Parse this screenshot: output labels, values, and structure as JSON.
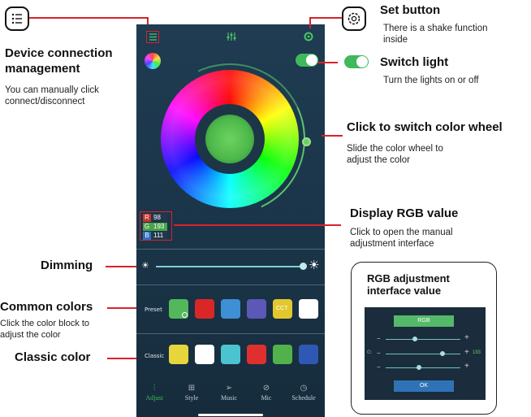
{
  "phone": {
    "rgb": {
      "r_label": "R",
      "r_value": "98",
      "g_label": "G",
      "g_value": "193",
      "b_label": "B",
      "b_value": "111"
    },
    "preset_label": "Preset",
    "classic_label": "Classic",
    "cct_label": "CCT",
    "preset_colors": [
      "#53b85b",
      "#d92727",
      "#3e8fd4",
      "#5b58b6",
      "#e3c72e",
      "#ffffff"
    ],
    "classic_colors": [
      "#e6d63a",
      "#ffffff",
      "#4cc4d0",
      "#df2f2f",
      "#52b14a",
      "#2f57b6"
    ],
    "nav": [
      {
        "label": "Adjust",
        "icon": "sliders-icon"
      },
      {
        "label": "Style",
        "icon": "grid-icon"
      },
      {
        "label": "Music",
        "icon": "music-icon"
      },
      {
        "label": "Mic",
        "icon": "mic-icon"
      },
      {
        "label": "Schedule",
        "icon": "clock-icon"
      }
    ],
    "accent": "#3fb95a"
  },
  "annotations": {
    "device_title_1": "Device connection",
    "device_title_2": "management",
    "device_desc_1": "You can manually click",
    "device_desc_2": "connect/disconnect",
    "set_title": "Set button",
    "set_desc_1": "There is a shake function",
    "set_desc_2": "inside",
    "switch_title": "Switch light",
    "switch_desc": "Turn the lights on or off",
    "wheel_title": "Click to switch color wheel",
    "wheel_desc_1": "Slide the color wheel to",
    "wheel_desc_2": "adjust the color",
    "rgb_title": "Display RGB value",
    "rgb_desc_1": "Click to open the manual",
    "rgb_desc_2": "adjustment interface",
    "dimming": "Dimming",
    "common_title": "Common colors",
    "common_desc_1": "Click the color block to",
    "common_desc_2": "adjust the color",
    "classic_title": "Classic color"
  },
  "rgb_panel": {
    "title_1": "RGB adjustment",
    "title_2": "interface value",
    "header_button": "RGB",
    "g_label": "G:",
    "g_value": "193",
    "ok_button": "OK"
  }
}
